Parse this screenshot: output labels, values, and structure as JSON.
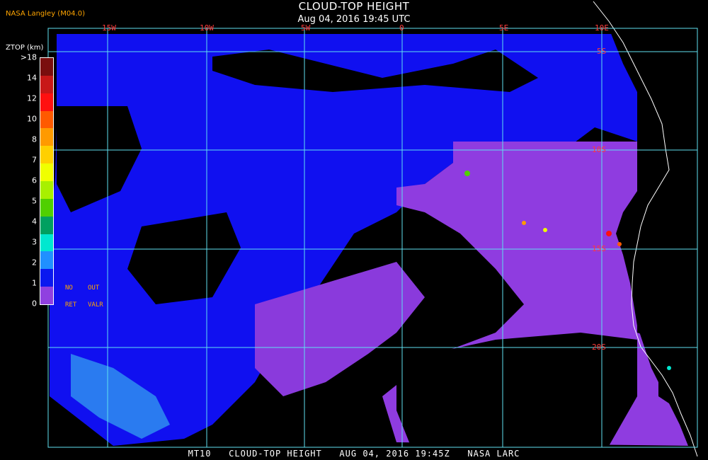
{
  "header": {
    "title": "CLOUD-TOP HEIGHT",
    "datetime": "Aug 04, 2016 19:45 UTC",
    "organization": "NASA Langley (M04.0)"
  },
  "footer": {
    "text": "MT10   CLOUD-TOP HEIGHT   AUG 04, 2016 19:45Z   NASA LARC"
  },
  "map": {
    "longitude_labels": [
      "15W",
      "10W",
      "5W",
      "0",
      "5E",
      "10E"
    ],
    "latitude_labels": [
      "5S",
      "10S",
      "15S",
      "20S"
    ],
    "grid_color": "#5fe0f0",
    "coastline_color": "#ffffff"
  },
  "legend": {
    "title": "ZTOP (km)",
    "labels": [
      ">18",
      "14",
      "12",
      "10",
      "8",
      "7",
      "6",
      "5",
      "4",
      "3",
      "2",
      "1",
      "0"
    ],
    "colors": [
      "#7a0e0e",
      "#c81818",
      "#ff1010",
      "#ff5a00",
      "#ff9a00",
      "#ffd000",
      "#f0ff00",
      "#a8f000",
      "#50d000",
      "#00a060",
      "#00e8d0",
      "#2090ff",
      "#0a18f0",
      "#9040e0"
    ],
    "notes": [
      "NO",
      "OUT",
      "RET",
      "VALR"
    ]
  }
}
